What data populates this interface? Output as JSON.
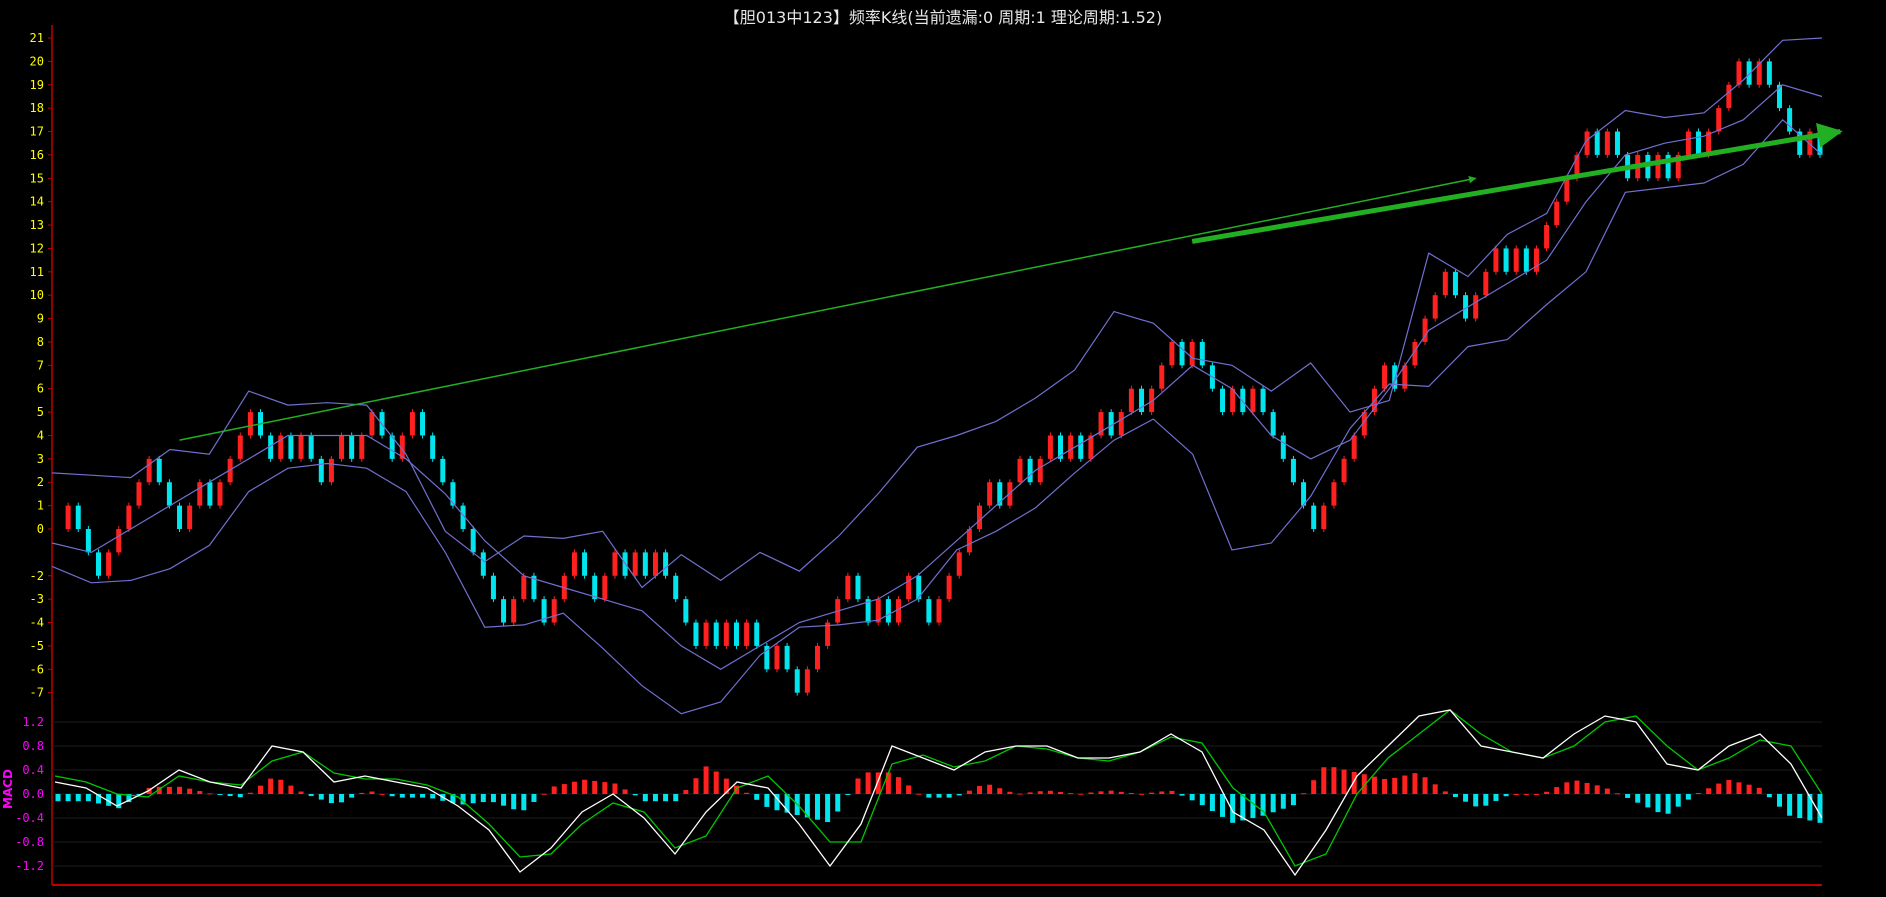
{
  "title": "【胆013中123】频率K线(当前遗漏:0 周期:1 理论周期:1.52)",
  "chart_data": [
    {
      "type": "candlestick",
      "name": "频率K线",
      "ylim": [
        -8,
        21.5
      ],
      "y_ticks": [
        21,
        20,
        19,
        18,
        17,
        16,
        15,
        14,
        13,
        12,
        11,
        10,
        9,
        8,
        7,
        6,
        5,
        4,
        3,
        2,
        1,
        0,
        -2,
        -3,
        -4,
        -5,
        -6,
        -7
      ],
      "colors": {
        "up": "#ff2020",
        "down": "#00e5ee",
        "band": "#7070d0",
        "axis": "#c00000",
        "ticks": "#ffff00"
      },
      "close_path": [
        0,
        1,
        0,
        -1,
        -2,
        -1,
        0,
        1,
        2,
        3,
        2,
        1,
        0,
        1,
        2,
        1,
        2,
        3,
        4,
        5,
        4,
        3,
        4,
        3,
        4,
        3,
        2,
        3,
        4,
        3,
        4,
        5,
        4,
        3,
        4,
        5,
        4,
        3,
        2,
        1,
        0,
        -1,
        -2,
        -3,
        -4,
        -3,
        -2,
        -3,
        -4,
        -3,
        -2,
        -1,
        -2,
        -3,
        -2,
        -1,
        -2,
        -1,
        -2,
        -1,
        -2,
        -3,
        -4,
        -5,
        -4,
        -5,
        -4,
        -5,
        -4,
        -5,
        -6,
        -5,
        -6,
        -7,
        -6,
        -5,
        -4,
        -3,
        -2,
        -3,
        -4,
        -3,
        -4,
        -3,
        -2,
        -3,
        -4,
        -3,
        -2,
        -1,
        0,
        1,
        2,
        1,
        2,
        3,
        2,
        3,
        4,
        3,
        4,
        3,
        4,
        5,
        4,
        5,
        6,
        5,
        6,
        7,
        8,
        7,
        8,
        7,
        6,
        5,
        6,
        5,
        6,
        5,
        4,
        3,
        2,
        1,
        0,
        1,
        2,
        3,
        4,
        5,
        6,
        7,
        6,
        7,
        8,
        9,
        10,
        11,
        10,
        9,
        10,
        11,
        12,
        11,
        12,
        11,
        12,
        13,
        14,
        15,
        16,
        17,
        16,
        17,
        16,
        15,
        16,
        15,
        16,
        15,
        16,
        17,
        16,
        17,
        18,
        19,
        20,
        19,
        20,
        19,
        18,
        17,
        16,
        17,
        16
      ],
      "band_upper": [
        2.4,
        2.3,
        2.2,
        3.4,
        3.2,
        5.9,
        5.3,
        5.4,
        5.3,
        3.2,
        -0.1,
        -1.4,
        -0.3,
        -0.4,
        -0.1,
        -2.5,
        -1.1,
        -2.2,
        -1.0,
        -1.8,
        -0.3,
        1.5,
        3.5,
        4.0,
        4.6,
        5.6,
        6.8,
        9.3,
        8.8,
        7.3,
        7.0,
        5.9,
        7.1,
        5.0,
        5.5,
        11.8,
        10.8,
        12.6,
        13.5,
        16.6,
        17.9,
        17.6,
        17.8,
        19.2,
        20.9,
        21.0
      ],
      "band_mid": [
        -0.6,
        -1.0,
        0.0,
        1.0,
        2.0,
        3.0,
        4.0,
        4.0,
        4.0,
        3.0,
        1.5,
        -0.5,
        -2.0,
        -2.5,
        -3.0,
        -3.5,
        -5.0,
        -6.0,
        -5.0,
        -4.0,
        -3.5,
        -3.0,
        -2.0,
        -0.5,
        1.0,
        2.5,
        3.5,
        4.5,
        5.5,
        7.0,
        6.0,
        4.0,
        3.0,
        3.8,
        6.0,
        8.5,
        9.5,
        10.5,
        11.5,
        14.0,
        16.0,
        16.5,
        16.8,
        17.5,
        19.0,
        18.5
      ],
      "band_lower": [
        -1.6,
        -2.3,
        -2.2,
        -1.7,
        -0.7,
        1.6,
        2.6,
        2.8,
        2.6,
        1.6,
        -1.0,
        -4.2,
        -4.1,
        -3.6,
        -5.1,
        -6.7,
        -7.9,
        -7.4,
        -5.4,
        -4.2,
        -4.1,
        -3.9,
        -3.0,
        -0.9,
        -0.1,
        0.9,
        2.4,
        3.8,
        4.7,
        3.2,
        -0.9,
        -0.6,
        1.4,
        4.3,
        6.2,
        6.1,
        7.8,
        8.1,
        9.6,
        11.0,
        14.4,
        14.6,
        14.8,
        15.6,
        17.5,
        16.0
      ],
      "arrows": [
        {
          "from": [
            12,
            3.8
          ],
          "to": [
            140,
            15.0
          ],
          "color": "#22b022"
        },
        {
          "from": [
            112,
            12.3
          ],
          "to": [
            176,
            17.0
          ],
          "color": "#22b022"
        }
      ]
    },
    {
      "type": "macd",
      "name": "MACD",
      "ylim": [
        -1.4,
        1.4
      ],
      "y_ticks": [
        1.2,
        0.8,
        0.4,
        0,
        -0.4,
        -0.8,
        -1.2
      ],
      "colors": {
        "dif": "#ffffff",
        "dea": "#00c800",
        "hist_pos": "#ff2020",
        "hist_neg": "#00e5ee",
        "ticks": "#ff00ff",
        "grid": "#1c1c1c"
      },
      "dif": [
        0.2,
        0.1,
        -0.2,
        0.05,
        0.4,
        0.2,
        0.1,
        0.8,
        0.7,
        0.2,
        0.3,
        0.2,
        0.1,
        -0.2,
        -0.6,
        -1.3,
        -0.9,
        -0.3,
        0.0,
        -0.4,
        -1.0,
        -0.3,
        0.2,
        0.1,
        -0.5,
        -1.2,
        -0.5,
        0.8,
        0.6,
        0.4,
        0.7,
        0.8,
        0.8,
        0.6,
        0.6,
        0.7,
        1.0,
        0.7,
        -0.3,
        -0.6,
        -1.35,
        -0.6,
        0.3,
        0.8,
        1.3,
        1.4,
        0.8,
        0.7,
        0.6,
        1.0,
        1.3,
        1.2,
        0.5,
        0.4,
        0.8,
        1.0,
        0.5,
        -0.4
      ],
      "dea": [
        0.3,
        0.2,
        0.0,
        -0.05,
        0.3,
        0.2,
        0.15,
        0.55,
        0.7,
        0.35,
        0.25,
        0.25,
        0.15,
        -0.05,
        -0.5,
        -1.05,
        -1.0,
        -0.5,
        -0.15,
        -0.3,
        -0.9,
        -0.7,
        0.1,
        0.3,
        -0.2,
        -0.8,
        -0.8,
        0.5,
        0.65,
        0.45,
        0.55,
        0.8,
        0.75,
        0.6,
        0.55,
        0.7,
        0.95,
        0.85,
        0.1,
        -0.3,
        -1.2,
        -1.0,
        0.0,
        0.6,
        1.0,
        1.4,
        1.0,
        0.7,
        0.6,
        0.8,
        1.2,
        1.3,
        0.8,
        0.4,
        0.6,
        0.9,
        0.8,
        0.0
      ]
    }
  ]
}
